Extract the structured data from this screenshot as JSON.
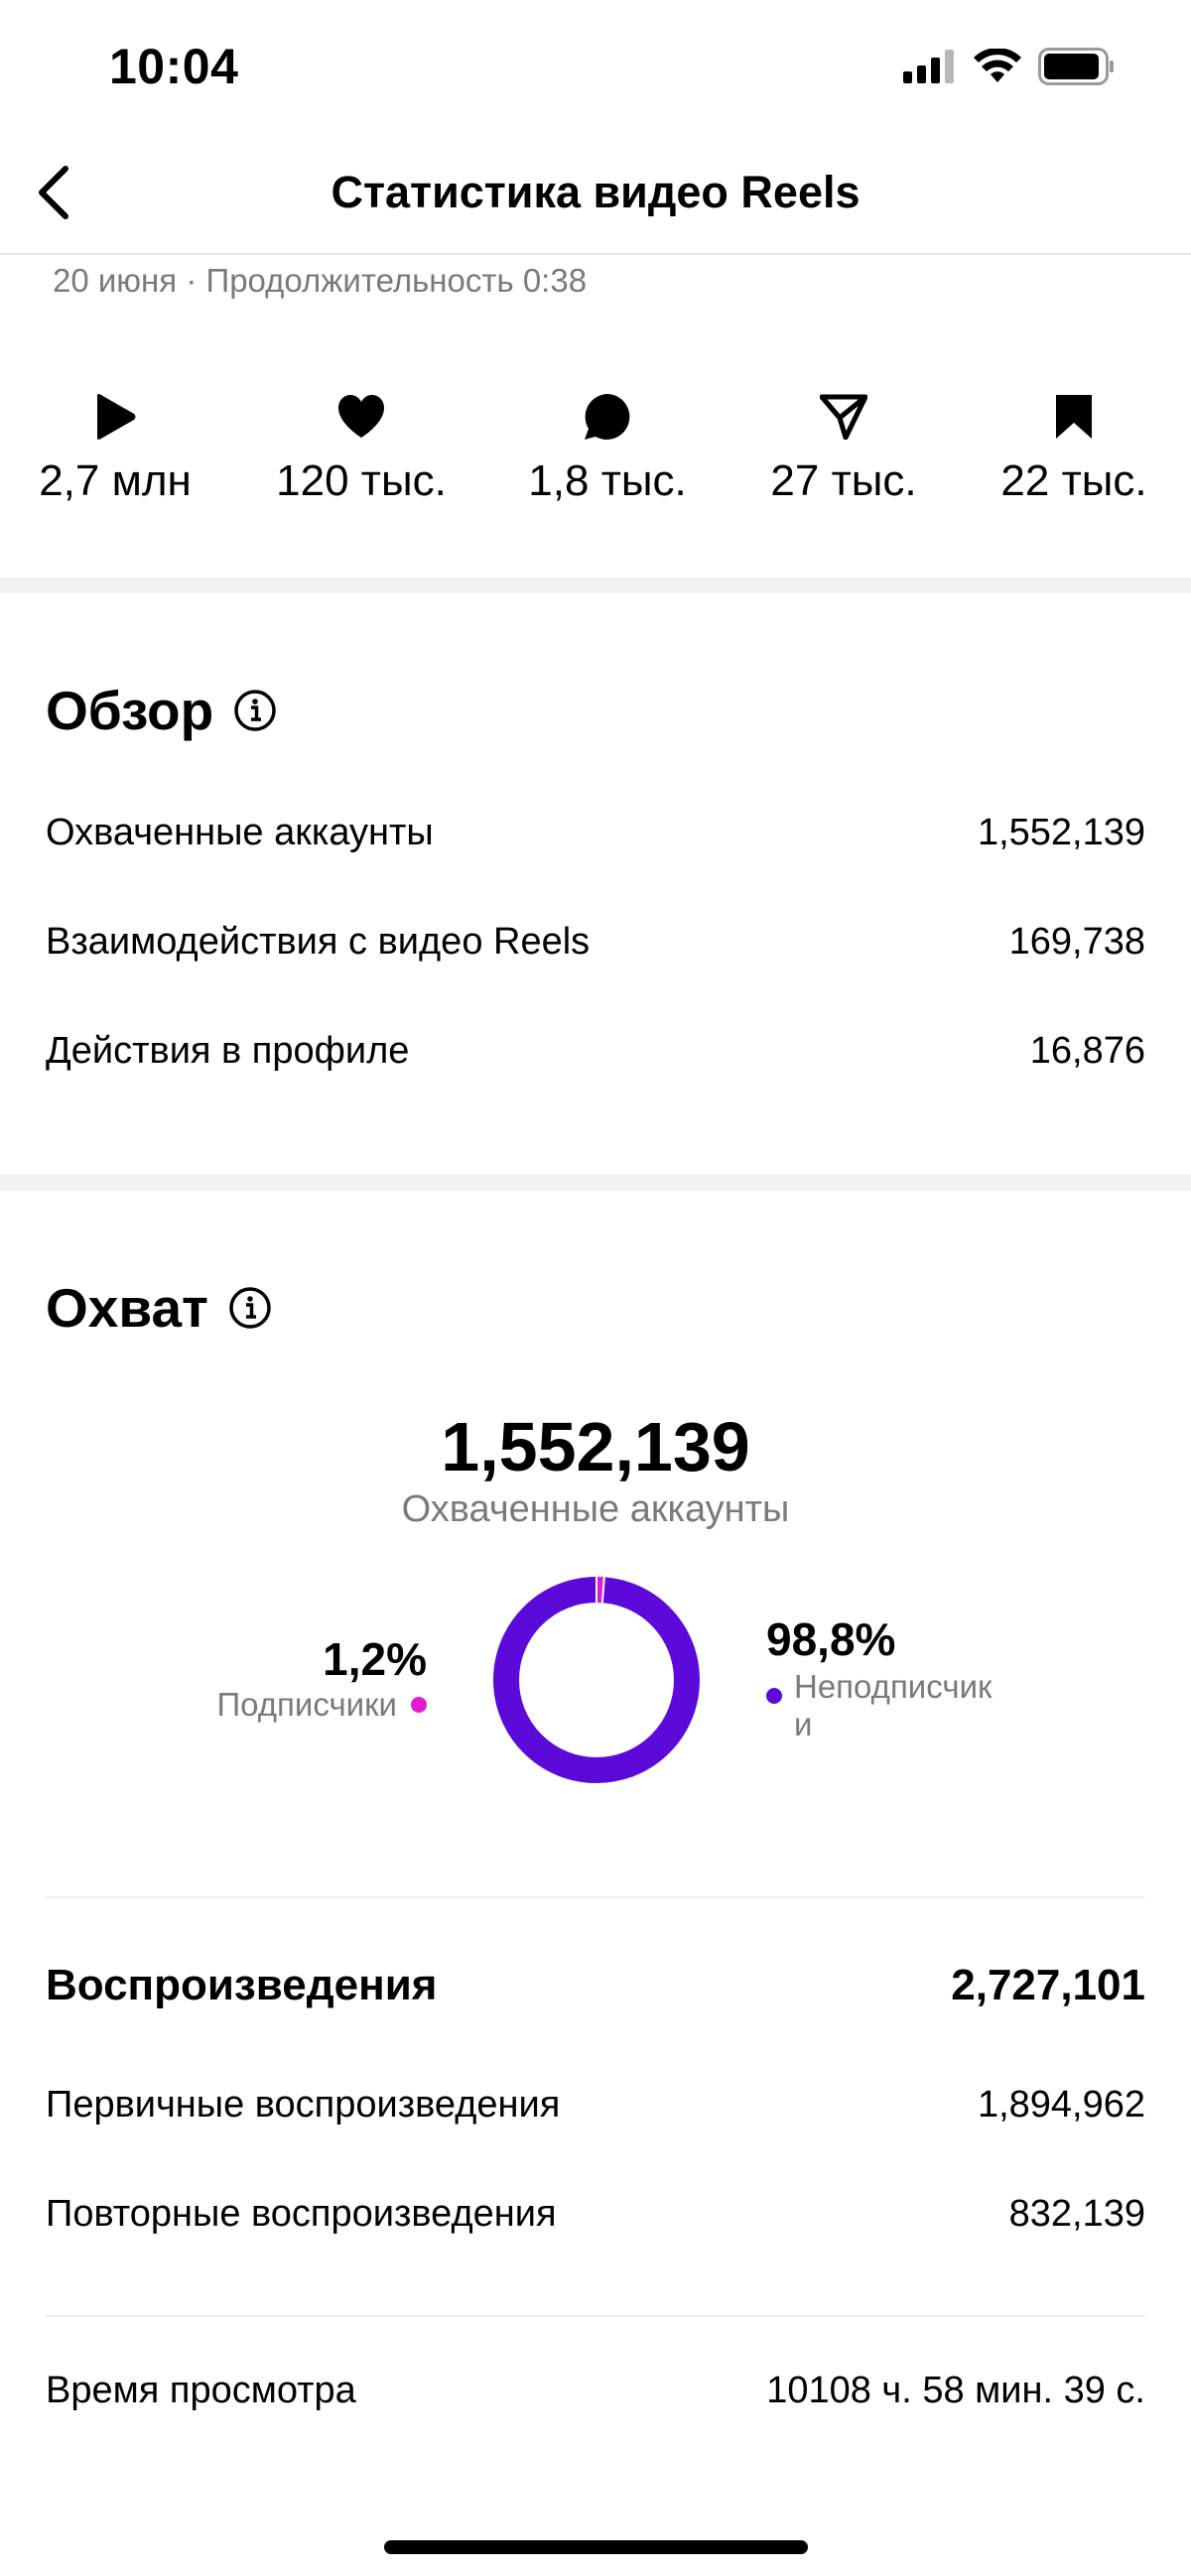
{
  "status_bar": {
    "time": "10:04"
  },
  "nav": {
    "title": "Статистика видео Reels"
  },
  "meta_line": "20 июня · Продолжительность 0:38",
  "metrics": [
    {
      "icon": "play-icon",
      "value": "2,7 млн"
    },
    {
      "icon": "heart-icon",
      "value": "120 тыс."
    },
    {
      "icon": "comment-icon",
      "value": "1,8 тыс."
    },
    {
      "icon": "send-icon",
      "value": "27 тыс."
    },
    {
      "icon": "bookmark-icon",
      "value": "22 тыс."
    }
  ],
  "overview": {
    "title": "Обзор",
    "rows": [
      {
        "label": "Охваченные аккаунты",
        "value": "1,552,139"
      },
      {
        "label": "Взаимодействия с видео Reels",
        "value": "169,738"
      },
      {
        "label": "Действия в профиле",
        "value": "16,876"
      }
    ]
  },
  "reach": {
    "title": "Охват",
    "total": "1,552,139",
    "total_label": "Охваченные аккаунты",
    "followers": {
      "pct": "1,2%",
      "label": "Подписчики",
      "fraction": 0.012,
      "color": "#e11bd2"
    },
    "non_followers": {
      "pct": "98,8%",
      "label_line1": "Неподписчик",
      "label_line2": "и",
      "fraction": 0.988,
      "color": "#5b0ad9"
    }
  },
  "plays": {
    "title": "Воспроизведения",
    "total": "2,727,101",
    "rows": [
      {
        "label": "Первичные воспроизведения",
        "value": "1,894,962"
      },
      {
        "label": "Повторные воспроизведения",
        "value": "832,139"
      }
    ]
  },
  "watch_time": {
    "label": "Время просмотра",
    "value": "10108 ч. 58 мин. 39 с."
  }
}
